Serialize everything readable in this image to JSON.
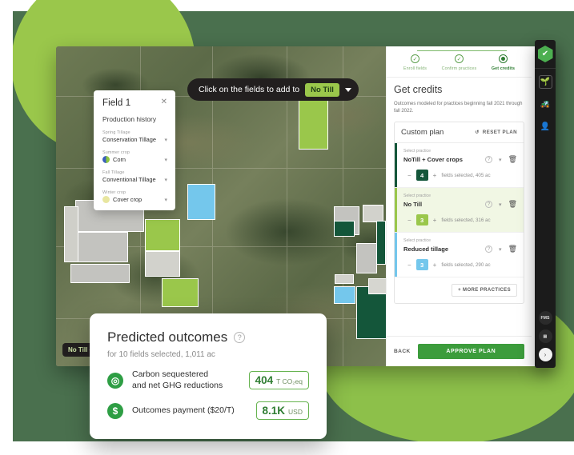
{
  "colors": {
    "bg_dark_green": "#4a704e",
    "blob_lime": "#9ac74b",
    "accent_dark_green": "#14563a",
    "accent_lime": "#9ac74b",
    "accent_blue": "#74c7ec",
    "approve_green": "#3c9c3c"
  },
  "map": {
    "tooltip": {
      "text": "Click on the fields to add to",
      "badge": "No Till",
      "caret_icon": "chevron-down-icon"
    },
    "corner_badge": "No Till +",
    "field_card": {
      "title": "Field 1",
      "close_icon": "close-icon",
      "section": "Production history",
      "rows": [
        {
          "label": "Spring Tillage",
          "value": "Conservation Tillage",
          "icon": null
        },
        {
          "label": "Summer crop",
          "value": "Corn",
          "icon": "corn-icon"
        },
        {
          "label": "Fall Tillage",
          "value": "Conventional Tillage",
          "icon": null
        },
        {
          "label": "Winter crop",
          "value": "Cover crop",
          "icon": "cover-crop-icon"
        }
      ]
    }
  },
  "panel": {
    "steps": [
      {
        "label": "Enroll fields",
        "state": "done"
      },
      {
        "label": "Confirm practices",
        "state": "done"
      },
      {
        "label": "Get credits",
        "state": "active"
      }
    ],
    "title": "Get credits",
    "description": "Outcomes modeled for practices beginning fall 2021 through fall 2022.",
    "plan": {
      "name": "Custom plan",
      "reset_label": "RESET PLAN",
      "reset_icon": "reset-icon",
      "practices": [
        {
          "select_label": "Select practice",
          "name": "NoTill + Cover crops",
          "help_icon": "question-icon",
          "dropdown_icon": "chevron-down-icon",
          "delete_icon": "trash-icon",
          "count": "4",
          "summary": "fields selected, 405 ac",
          "accent": "dark-green"
        },
        {
          "select_label": "Select practice",
          "name": "No Till",
          "help_icon": "question-icon",
          "dropdown_icon": "chevron-down-icon",
          "delete_icon": "trash-icon",
          "count": "3",
          "summary": "fields selected, 316 ac",
          "accent": "lime"
        },
        {
          "select_label": "Select practice",
          "name": "Reduced tillage",
          "help_icon": "question-icon",
          "dropdown_icon": "chevron-down-icon",
          "delete_icon": "trash-icon",
          "count": "3",
          "summary": "fields selected, 290 ac",
          "accent": "blue"
        }
      ],
      "more_label": "+ MORE PRACTICES"
    },
    "back_label": "BACK",
    "approve_label": "APPROVE PLAN"
  },
  "rail": {
    "logo_icon": "leaf-check-logo",
    "items": [
      {
        "icon": "field-scout-icon",
        "boxed": true
      },
      {
        "icon": "tractor-icon",
        "boxed": false
      },
      {
        "icon": "user-account-icon",
        "boxed": false
      }
    ],
    "bottom": [
      {
        "icon": "fms-badge",
        "label": "FMS"
      },
      {
        "icon": "chat-icon",
        "label": ""
      },
      {
        "icon": "chevron-right-icon",
        "label": ""
      }
    ]
  },
  "outcomes": {
    "title": "Predicted outcomes",
    "help_icon": "question-icon",
    "subtitle": "for 10 fields selected, 1,011 ac",
    "rows": [
      {
        "icon": "carbon-icon",
        "label": "Carbon sequestered and net GHG reductions",
        "label_line1": "Carbon sequestered",
        "label_line2": "and net GHG reductions",
        "value": "404",
        "unit": "T CO₂eq"
      },
      {
        "icon": "dollar-icon",
        "label": "Outcomes payment ($20/T)",
        "label_line1": "Outcomes payment ($20/T)",
        "label_line2": "",
        "value": "8.1K",
        "unit": "USD"
      }
    ]
  }
}
